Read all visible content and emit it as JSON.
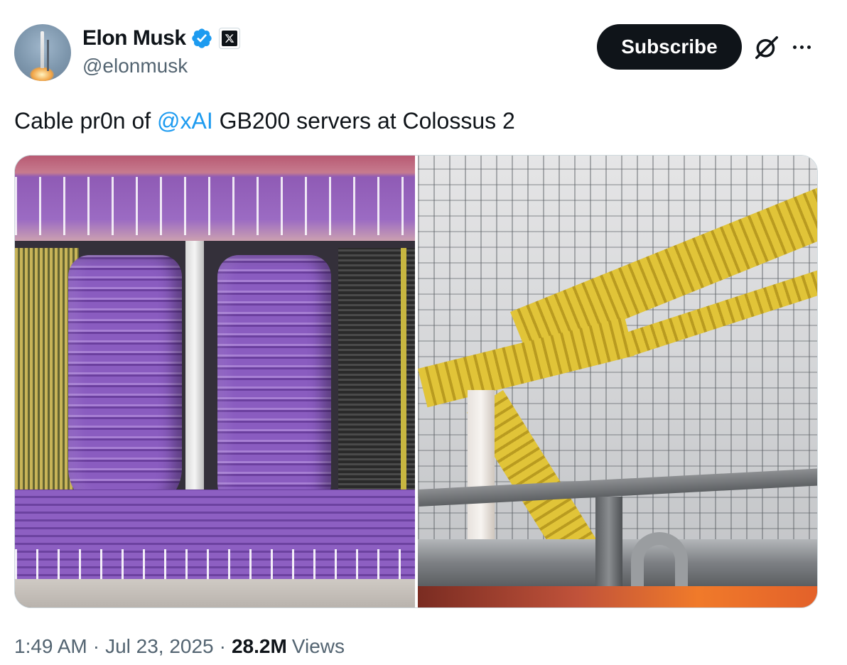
{
  "author": {
    "display_name": "Elon Musk",
    "handle": "@elonmusk",
    "avatar_icon": "avatar-rocket-launch",
    "verified_icon": "verified-badge-icon",
    "affiliation_icon": "x-logo-icon"
  },
  "actions": {
    "subscribe_label": "Subscribe",
    "grok_icon": "grok-icon",
    "more_icon": "more-icon"
  },
  "tweet": {
    "text_before": "Cable pr0n of ",
    "mention": "@xAI",
    "text_after": " GB200 servers at Colossus 2"
  },
  "media": [
    {
      "description_icon": "photo-purple-cables"
    },
    {
      "description_icon": "photo-yellow-cable-trays"
    }
  ],
  "meta": {
    "time": "1:49 AM",
    "separator": "·",
    "date": "Jul 23, 2025",
    "views_count": "28.2M",
    "views_label": "Views"
  },
  "colors": {
    "link": "#1d9bf0",
    "verified": "#1d9bf0",
    "text": "#0f1419",
    "secondary_text": "#536471",
    "button_bg": "#0f1419"
  }
}
